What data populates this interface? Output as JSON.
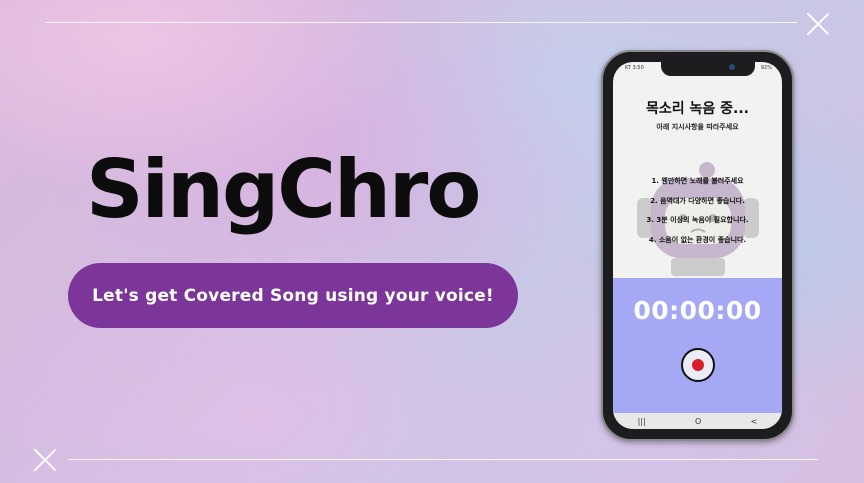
{
  "slide": {
    "title": "SingChro",
    "tagline": "Let's get Covered Song using your voice!"
  },
  "phone": {
    "status_left": "KT 3:50",
    "status_right": "92%",
    "screen_title": "목소리 녹음 중...",
    "screen_subtitle": "아래 지시사항을 따라주세요",
    "instructions": [
      "1. 웬만하면 노래를 불러주세요",
      "2. 음역대가 다양하면 좋습니다.",
      "3. 3분 이상의 녹음이 필요합니다.",
      "4. 소음이 없는 환경이 좋습니다."
    ],
    "timer": "00:00:00",
    "record_color": "#d81e2a",
    "panel_color": "#a5a9f5",
    "nav": [
      "|||",
      "O",
      "<"
    ]
  },
  "colors": {
    "pill": "#7c3599",
    "title": "#0c0c0c"
  }
}
